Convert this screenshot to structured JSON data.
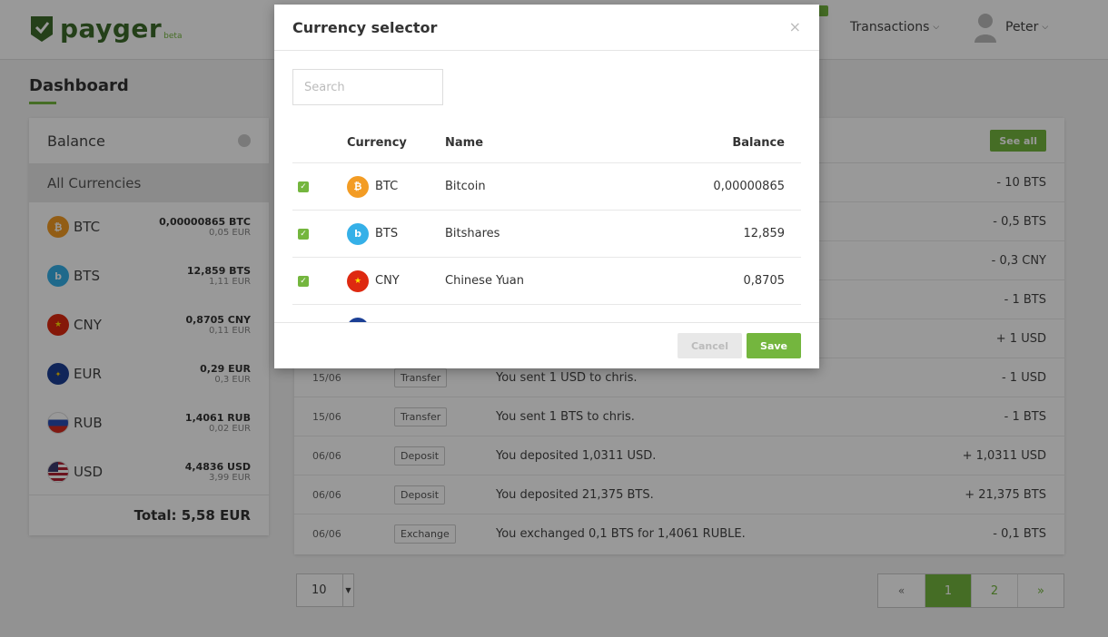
{
  "header": {
    "logo_text": "payger",
    "logo_beta": "beta",
    "nav_transactions": "Transactions",
    "user_name": "Peter"
  },
  "page": {
    "title": "Dashboard"
  },
  "balance": {
    "title": "Balance",
    "all_currencies": "All Currencies",
    "items": [
      {
        "code": "BTC",
        "amount": "0,00000865 BTC",
        "eur": "0,05 EUR",
        "icon": "bitcoin-icon"
      },
      {
        "code": "BTS",
        "amount": "12,859 BTS",
        "eur": "1,11 EUR",
        "icon": "bitshares-icon"
      },
      {
        "code": "CNY",
        "amount": "0,8705 CNY",
        "eur": "0,11 EUR",
        "icon": "china-flag-icon"
      },
      {
        "code": "EUR",
        "amount": "0,29 EUR",
        "eur": "0,3 EUR",
        "icon": "eu-flag-icon"
      },
      {
        "code": "RUB",
        "amount": "1,4061 RUB",
        "eur": "0,02 EUR",
        "icon": "russia-flag-icon"
      },
      {
        "code": "USD",
        "amount": "4,4836 USD",
        "eur": "3,99 EUR",
        "icon": "usa-flag-icon"
      }
    ],
    "total": "Total: 5,58 EUR"
  },
  "transactions": {
    "see_all": "See all",
    "rows": [
      {
        "date": "",
        "type": "",
        "desc": "",
        "amount": "- 10 BTS"
      },
      {
        "date": "",
        "type": "",
        "desc": "",
        "amount": "- 0,5 BTS"
      },
      {
        "date": "",
        "type": "",
        "desc": "",
        "amount": "- 0,3 CNY"
      },
      {
        "date": "",
        "type": "",
        "desc": "",
        "amount": "- 1 BTS"
      },
      {
        "date": "",
        "type": "",
        "desc": "",
        "amount": "+ 1 USD"
      },
      {
        "date": "15/06",
        "type": "Transfer",
        "desc": "You sent 1 USD to chris.",
        "amount": "- 1 USD"
      },
      {
        "date": "15/06",
        "type": "Transfer",
        "desc": "You sent 1 BTS to chris.",
        "amount": "- 1 BTS"
      },
      {
        "date": "06/06",
        "type": "Deposit",
        "desc": "You deposited 1,0311 USD.",
        "amount": "+ 1,0311 USD"
      },
      {
        "date": "06/06",
        "type": "Deposit",
        "desc": "You deposited 21,375 BTS.",
        "amount": "+ 21,375 BTS"
      },
      {
        "date": "06/06",
        "type": "Exchange",
        "desc": "You exchanged 0,1 BTS for 1,4061 RUBLE.",
        "amount": "- 0,1 BTS"
      }
    ]
  },
  "pagination": {
    "per_page": "10",
    "prev": "«",
    "pages": [
      "1",
      "2"
    ],
    "active_page": "1",
    "next": "»"
  },
  "modal": {
    "title": "Currency selector",
    "close": "×",
    "search_placeholder": "Search",
    "columns": {
      "currency": "Currency",
      "name": "Name",
      "balance": "Balance"
    },
    "rows": [
      {
        "code": "BTC",
        "name": "Bitcoin",
        "balance": "0,00000865",
        "checked": true,
        "icon": "bitcoin-icon"
      },
      {
        "code": "BTS",
        "name": "Bitshares",
        "balance": "12,859",
        "checked": true,
        "icon": "bitshares-icon"
      },
      {
        "code": "CNY",
        "name": "Chinese Yuan",
        "balance": "0,8705",
        "checked": true,
        "icon": "china-flag-icon"
      }
    ],
    "cancel": "Cancel",
    "save": "Save"
  },
  "colors": {
    "brand_green": "#74b63e",
    "logo_dark_green": "#3d6b2b",
    "btc_orange": "#f39c24",
    "bts_blue": "#35b0e8"
  }
}
